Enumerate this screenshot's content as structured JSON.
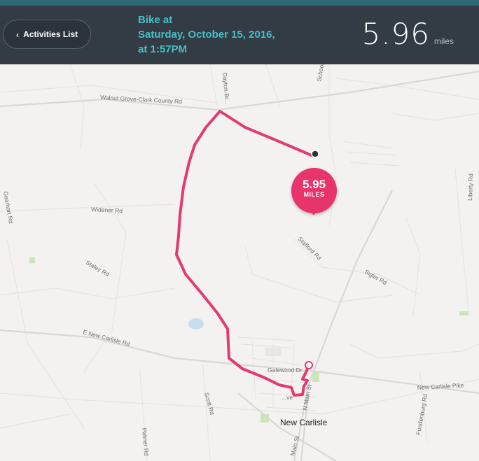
{
  "header": {
    "back_label": "Activities List",
    "title_line1": "Bike at",
    "title_line2": "Saturday, October 15, 2016,",
    "title_line3": "at 1:57PM",
    "distance_value": "5.96",
    "distance_unit": "miles"
  },
  "map": {
    "badge_value": "5.95",
    "badge_unit": "MILES",
    "route_color": "#e23b6e",
    "labels": {
      "walnut_grove": "Walnut Grove-Clark County Rd",
      "dayton": "Dayton-Br...",
      "school": "School Rd",
      "gearhart": "Gearhart Rd",
      "widener": "Widener Rd",
      "liberty": "Liberty Rd",
      "stafford": "Stafford Rd",
      "staley": "Staley Rd",
      "sigler": "Sigler Rd",
      "e_new_carlisle": "E New Carlisle Rd",
      "galewood": "Galewood Dr",
      "new_carlisle_pike": "New Carlisle Pike",
      "n_main": "N Main St",
      "scott": "Scott Rd",
      "ave": "...ve",
      "fundenburg": "Fundenburg Rd",
      "palmer": "Palmer Rd",
      "main": "Main St",
      "town": "New Carlisle"
    }
  }
}
